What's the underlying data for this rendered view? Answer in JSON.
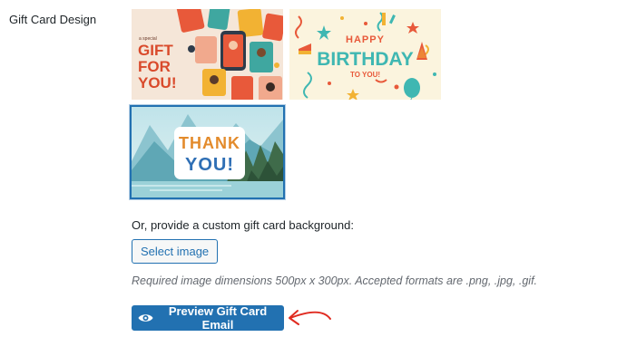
{
  "field": {
    "label": "Gift Card Design"
  },
  "designs": [
    {
      "id": "gift",
      "small_text": "a special",
      "lines": [
        "GIFT",
        "FOR",
        "YOU!"
      ],
      "selected": false
    },
    {
      "id": "birthday",
      "lines": [
        "HAPPY",
        "BIRTHDAY",
        "TO YOU!"
      ],
      "selected": false
    },
    {
      "id": "thank-you",
      "lines": [
        "THANK",
        "YOU!"
      ],
      "selected": true
    }
  ],
  "custom": {
    "prompt": "Or, provide a custom gift card background:",
    "select_label": "Select image",
    "hint": "Required image dimensions 500px x 300px. Accepted formats are .png, .jpg, .gif."
  },
  "preview": {
    "label": "Preview Gift Card Email",
    "icon": "eye-icon"
  },
  "colors": {
    "primary": "#2271b1",
    "annotation_arrow": "#e02b20",
    "gift_text": "#d94a2b",
    "birthday_text": "#3fb7b2"
  }
}
